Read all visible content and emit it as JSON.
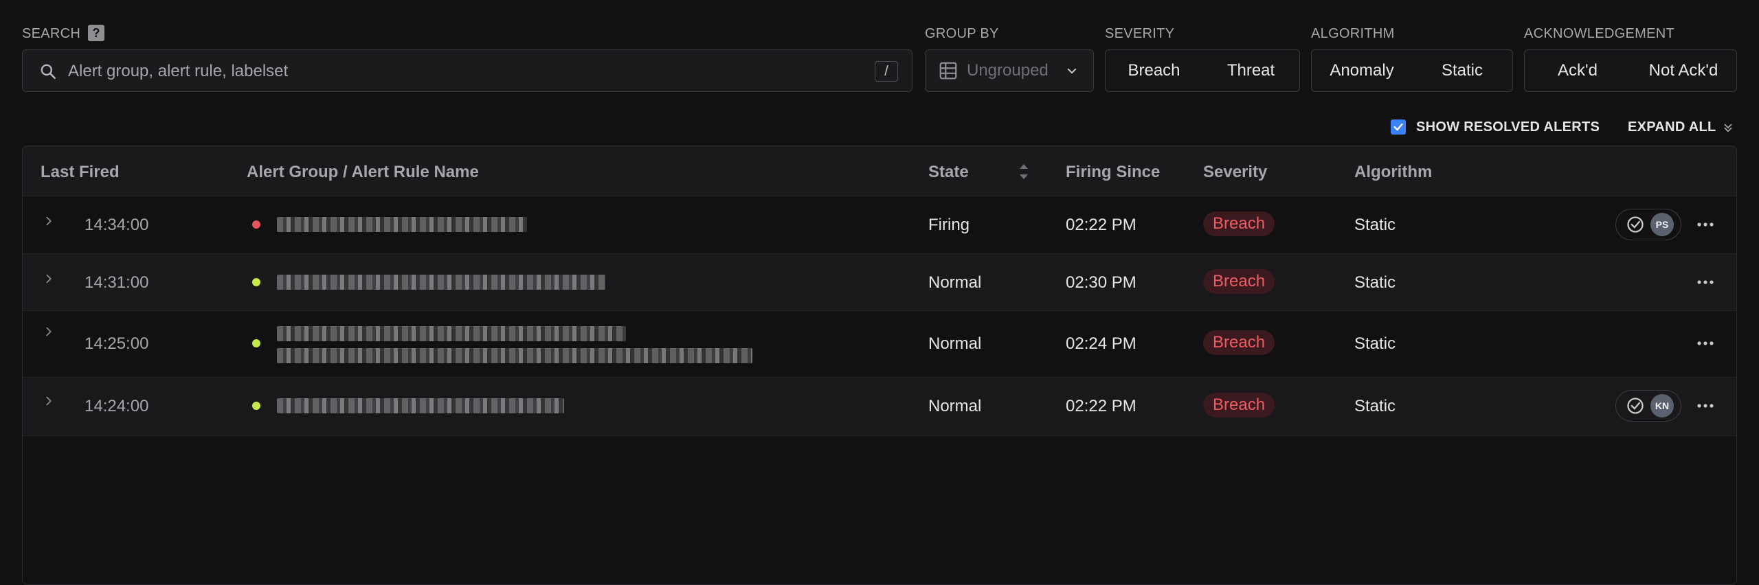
{
  "search": {
    "label": "SEARCH",
    "help": "?",
    "placeholder": "Alert group, alert rule, labelset",
    "value": "",
    "shortcut": "/"
  },
  "group_by": {
    "label": "GROUP BY",
    "value": "Ungrouped"
  },
  "severity": {
    "label": "SEVERITY",
    "options": [
      "Breach",
      "Threat"
    ]
  },
  "algorithm": {
    "label": "ALGORITHM",
    "options": [
      "Anomaly",
      "Static"
    ]
  },
  "acknowledgement": {
    "label": "ACKNOWLEDGEMENT",
    "options": [
      "Ack'd",
      "Not Ack'd"
    ]
  },
  "show_resolved": {
    "label": "SHOW RESOLVED ALERTS",
    "checked": true
  },
  "expand_all": {
    "label": "EXPAND ALL"
  },
  "table": {
    "columns": [
      "Last Fired",
      "Alert Group / Alert Rule Name",
      "State",
      "Firing Since",
      "Severity",
      "Algorithm"
    ],
    "rows": [
      {
        "last_fired": "14:34:00",
        "state": "Firing",
        "firing_since": "02:22 PM",
        "severity": "Breach",
        "algorithm": "Static",
        "ack_by": "PS"
      },
      {
        "last_fired": "14:31:00",
        "state": "Normal",
        "firing_since": "02:30 PM",
        "severity": "Breach",
        "algorithm": "Static"
      },
      {
        "last_fired": "14:25:00",
        "state": "Normal",
        "firing_since": "02:24 PM",
        "severity": "Breach",
        "algorithm": "Static"
      },
      {
        "last_fired": "14:24:00",
        "state": "Normal",
        "firing_since": "02:22 PM",
        "severity": "Breach",
        "algorithm": "Static",
        "ack_by": "KN"
      }
    ]
  },
  "colors": {
    "firing": "#e5555f",
    "normal": "#c5e84a",
    "breach_text": "#ef5b63",
    "breach_bg": "#3a1a1e",
    "checkbox": "#3b82f6"
  },
  "icons": {
    "search": "search-icon",
    "group": "table-grid-icon",
    "expand": "chevrons-down-icon",
    "row_expand": "chevron-right-icon",
    "ack": "check-circle-icon",
    "more": "more-horizontal-icon",
    "sort": "sort-icon"
  }
}
